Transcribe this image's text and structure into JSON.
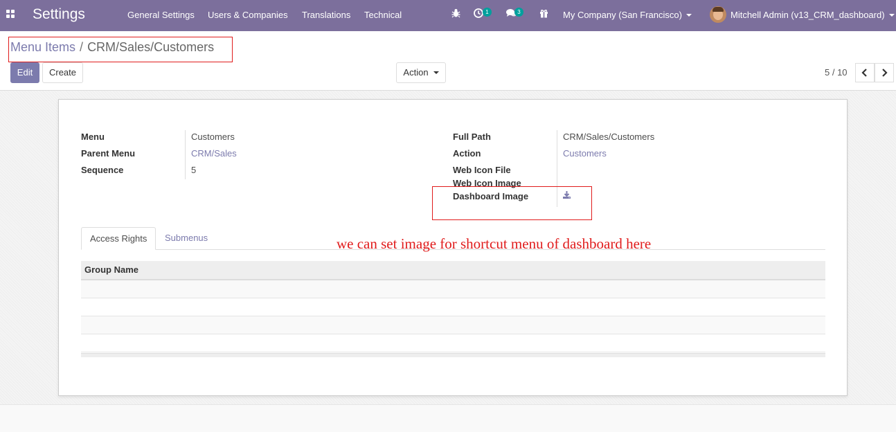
{
  "navbar": {
    "brand": "Settings",
    "menu": [
      "General Settings",
      "Users & Companies",
      "Translations",
      "Technical"
    ],
    "activity_count": "1",
    "messages_count": "3",
    "company": "My Company (San Francisco)",
    "user": "Mitchell Admin (v13_CRM_dashboard)"
  },
  "breadcrumb": {
    "parent": "Menu Items",
    "separator": "/",
    "current": "CRM/Sales/Customers"
  },
  "buttons": {
    "edit": "Edit",
    "create": "Create",
    "action": "Action"
  },
  "pager": {
    "value": "5 / 10",
    "prev_icon": "chevron-left",
    "next_icon": "chevron-right"
  },
  "form": {
    "left": [
      {
        "label": "Menu",
        "value": "Customers"
      },
      {
        "label": "Parent Menu",
        "value": "CRM/Sales"
      },
      {
        "label": "Sequence",
        "value": "5"
      }
    ],
    "right": [
      {
        "label": "Full Path",
        "value": "CRM/Sales/Customers"
      },
      {
        "label": "Action",
        "value": "Customers"
      },
      {
        "label": "Web Icon File",
        "value": ""
      },
      {
        "label": "Web Icon Image",
        "value": ""
      },
      {
        "label": "Dashboard Image",
        "value": ""
      }
    ]
  },
  "tabs": [
    "Access Rights",
    "Submenus"
  ],
  "table": {
    "headers": [
      "Group Name"
    ],
    "rows": []
  },
  "annotation": "we can set image for shortcut menu of dashboard here",
  "colors": {
    "navbar": "#7c6f9c",
    "primary": "#7c7bad",
    "highlight": "#e01b1b",
    "badge": "#00a09d"
  }
}
